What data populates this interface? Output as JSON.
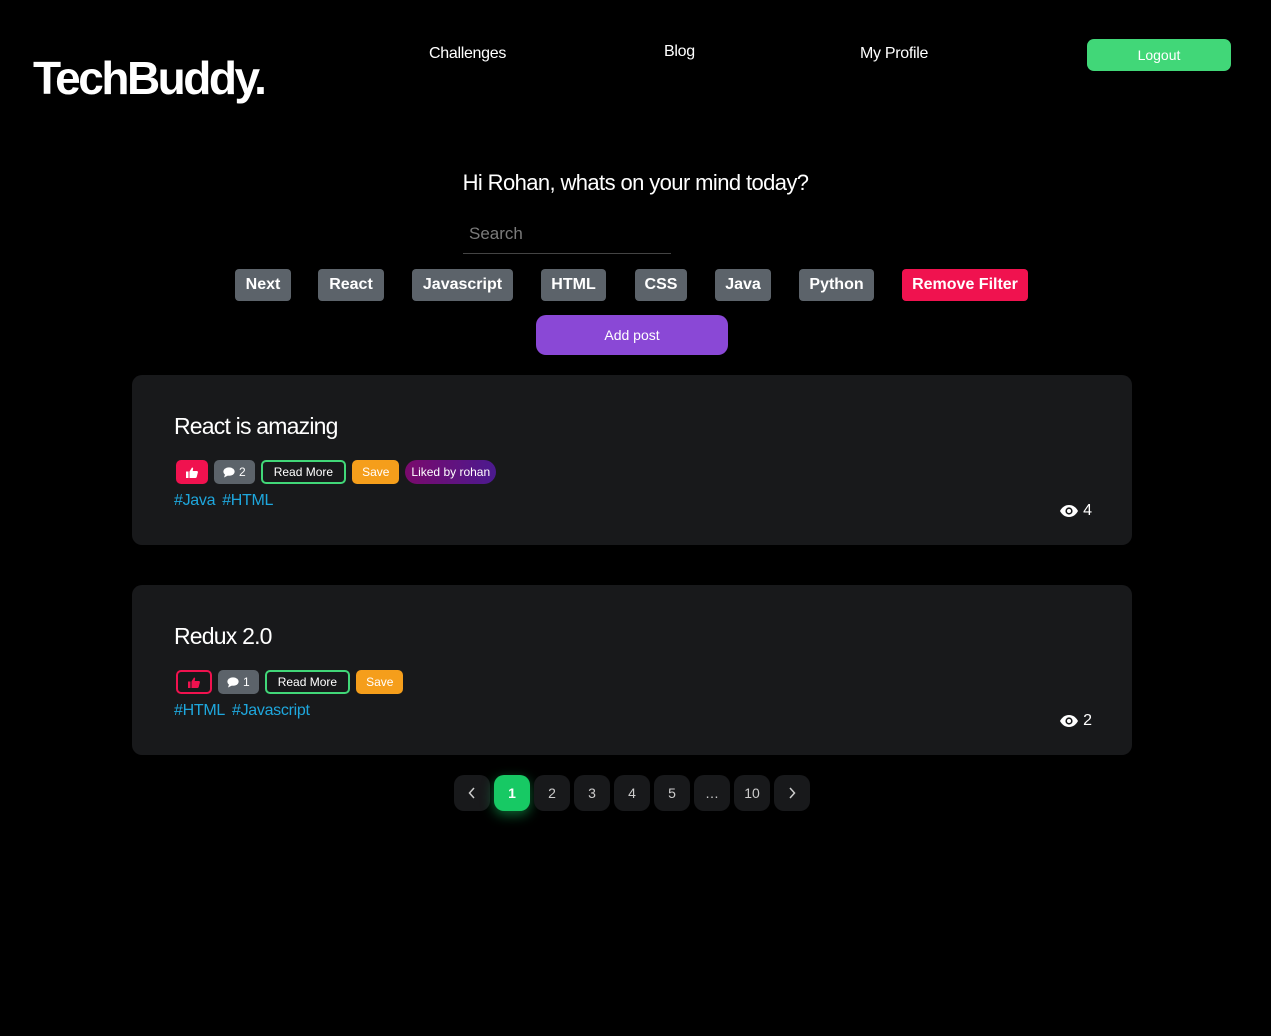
{
  "header": {
    "logo": "TechBuddy.",
    "nav": [
      "Challenges",
      "Blog",
      "My Profile"
    ],
    "logout": "Logout"
  },
  "main": {
    "greeting": "Hi Rohan, whats on your mind today?",
    "search_placeholder": "Search",
    "filters": [
      "Next",
      "React",
      "Javascript",
      "HTML",
      "CSS",
      "Java",
      "Python"
    ],
    "remove_filter": "Remove Filter",
    "add_post": "Add post"
  },
  "posts": [
    {
      "title": "React is amazing",
      "liked": true,
      "comments": "2",
      "read_more": "Read More",
      "save": "Save",
      "liked_by": "Liked by rohan",
      "tags": [
        "#Java",
        "#HTML"
      ],
      "views": "4"
    },
    {
      "title": "Redux 2.0",
      "liked": false,
      "comments": "1",
      "read_more": "Read More",
      "save": "Save",
      "tags": [
        "#HTML",
        "#Javascript"
      ],
      "views": "2"
    }
  ],
  "pagination": {
    "pages": [
      "1",
      "2",
      "3",
      "4",
      "5",
      "…",
      "10"
    ],
    "current": "1"
  },
  "colors": {
    "accent_green": "#41d778",
    "active_page": "#17c964",
    "like_red": "#f0124f",
    "add_post_purple": "#8a48d6",
    "save_orange": "#f59e1b",
    "hashtag_blue": "#1ea7dd"
  },
  "icons": {
    "like": "thumbs-up-icon",
    "comment": "comment-icon",
    "views": "eye-icon",
    "prev": "chevron-left-icon",
    "next": "chevron-right-icon"
  }
}
